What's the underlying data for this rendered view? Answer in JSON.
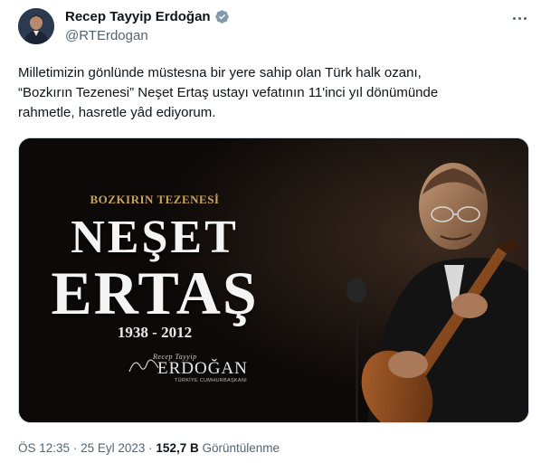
{
  "author": {
    "display_name": "Recep Tayyip Erdoğan",
    "handle": "@RTErdogan"
  },
  "tweet": {
    "text_lines": [
      "Milletimizin gönlünde müstesna bir yere sahip olan Türk halk ozanı,",
      "“Bozkırın Tezenesi” Neşet Ertaş ustayı vefatının 11'inci yıl dönümünde",
      "rahmetle, hasretle yâd ediyorum."
    ]
  },
  "media": {
    "subtitle": "BOZKIRIN TEZENESİ",
    "first_name": "NEŞET",
    "last_name": "ERTAŞ",
    "years": "1938 - 2012",
    "signature_script": "Recep Tayyip",
    "signature_name": "ERDOĞAN",
    "signature_office": "TÜRKİYE CUMHURBAŞKANI"
  },
  "meta": {
    "time": "ÖS 12:35",
    "separator": "·",
    "date": "25 Eyl 2023",
    "views_count": "152,7 B",
    "views_label": "Görüntülenme"
  },
  "icons": {
    "verified": "verified-badge-icon",
    "more": "more-options-icon"
  },
  "colors": {
    "verified_badge": "#829aab",
    "secondary_text": "#536471",
    "poster_gold": "#c9a55a"
  }
}
